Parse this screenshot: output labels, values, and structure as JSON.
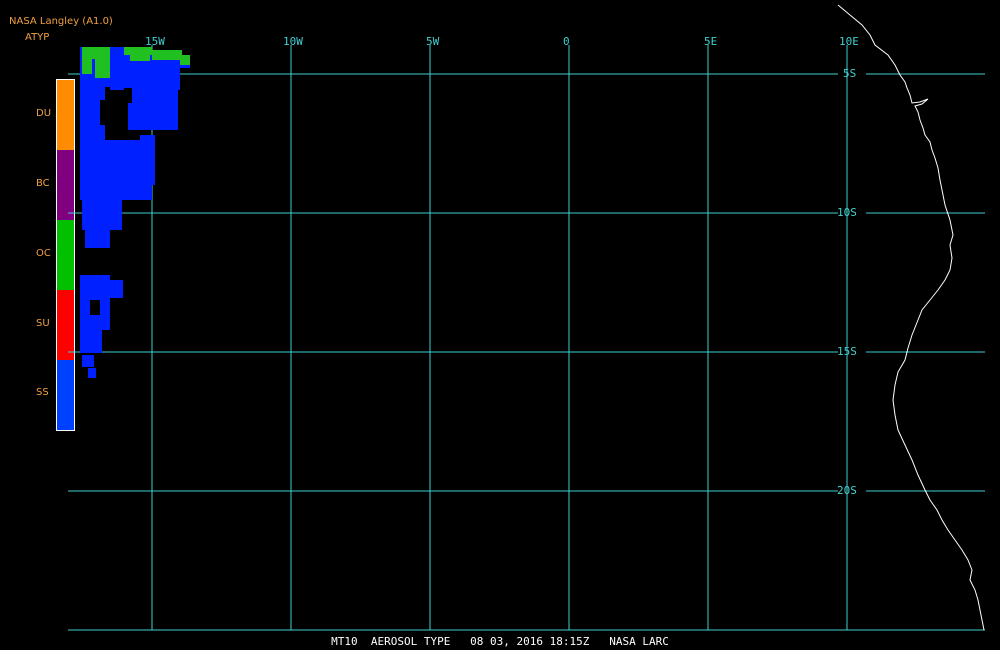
{
  "header": {
    "title": "NASA Langley (A1.0)",
    "product": "ATYP"
  },
  "legend": [
    {
      "code": "DU",
      "color": "#ff8c00"
    },
    {
      "code": "BC",
      "color": "#800080"
    },
    {
      "code": "OC",
      "color": "#00c000"
    },
    {
      "code": "SU",
      "color": "#ff0000"
    },
    {
      "code": "SS",
      "color": "#0040ff"
    }
  ],
  "longitude_labels": [
    "15W",
    "10W",
    "5W",
    "0",
    "5E",
    "10E"
  ],
  "latitude_labels": [
    "5S",
    "10S",
    "15S",
    "20S"
  ],
  "footer": "MT10  AEROSOL TYPE   08 03, 2016 18:15Z   NASA LARC",
  "colors": {
    "grid": "#40d0d0",
    "coastline": "#ffffff",
    "background": "#000000"
  }
}
